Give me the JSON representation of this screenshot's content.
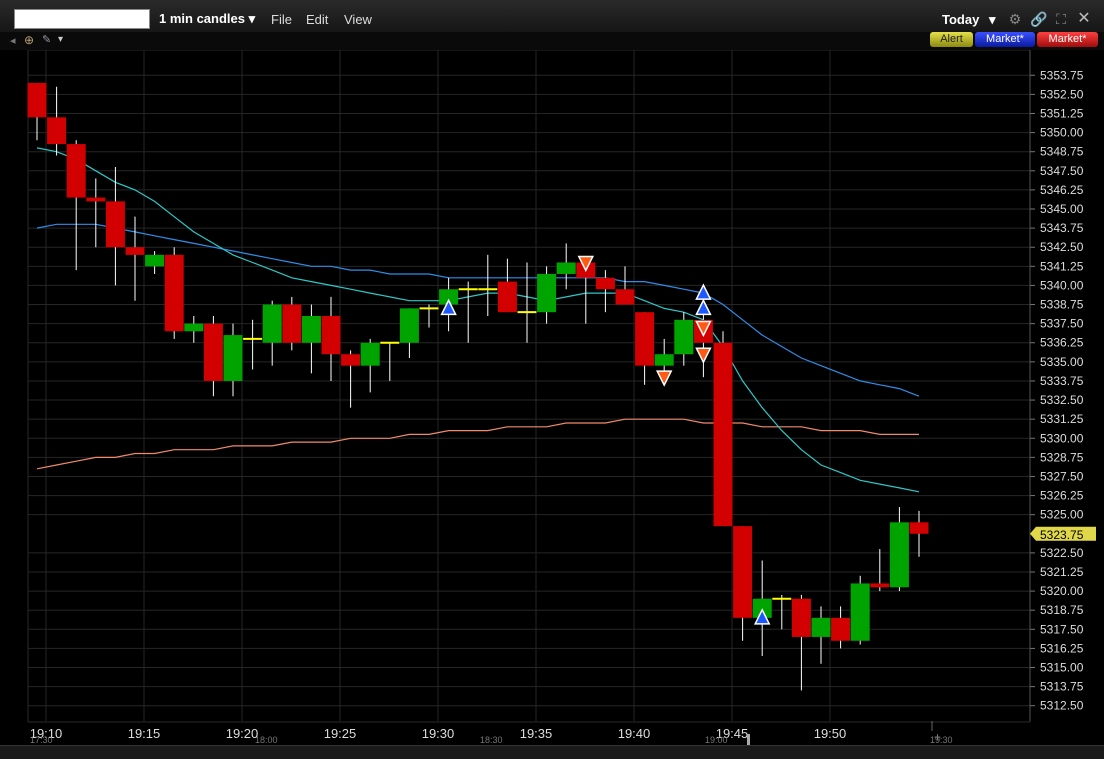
{
  "toolbar": {
    "symbol_value": "",
    "interval_label": "1 min candles",
    "menu": [
      "File",
      "Edit",
      "View"
    ],
    "period_label": "Today",
    "icons": [
      "dropdown-caret",
      "gear-icon",
      "link-icon",
      "expand-icon",
      "close-icon"
    ]
  },
  "badges": {
    "alert": "Alert",
    "market_buy": "Market*",
    "market_sell": "Market*"
  },
  "colors": {
    "up": "#00a400",
    "down": "#d20000",
    "price_tag": "#e0d84a",
    "buy_arrow": "#1f57ff",
    "sell_arrow": "#ff5a14",
    "ma_fast": "#2ec8c8",
    "ma_mid": "#2f8ee8",
    "ma_slow": "#f08a6a"
  },
  "chart_data": {
    "type": "candlestick",
    "current_price": "5323.75",
    "y_ticks": [
      "5353.75",
      "5352.50",
      "5351.25",
      "5350.00",
      "5348.75",
      "5347.50",
      "5346.25",
      "5345.00",
      "5343.75",
      "5342.50",
      "5341.25",
      "5340.00",
      "5338.75",
      "5337.50",
      "5336.25",
      "5335.00",
      "5333.75",
      "5332.50",
      "5331.25",
      "5330.00",
      "5328.75",
      "5327.50",
      "5326.25",
      "5325.00",
      "5322.50",
      "5321.25",
      "5320.00",
      "5318.75",
      "5317.50",
      "5316.25",
      "5315.00",
      "5313.75",
      "5312.50"
    ],
    "ylim": [
      5311.5,
      5354.75
    ],
    "x_ticks": [
      "19:10",
      "19:15",
      "19:20",
      "19:25",
      "19:30",
      "19:35",
      "19:40",
      "19:45",
      "19:50"
    ],
    "mini_ticks": [
      "17:30",
      "18:00",
      "18:30",
      "19:00",
      "19:30"
    ],
    "candles": [
      {
        "o": 5353.25,
        "h": 5353.25,
        "l": 5349.5,
        "c": 5351.0
      },
      {
        "o": 5351.0,
        "h": 5353.0,
        "l": 5348.5,
        "c": 5349.25
      },
      {
        "o": 5349.25,
        "h": 5349.5,
        "l": 5341.0,
        "c": 5345.75
      },
      {
        "o": 5345.75,
        "h": 5347.0,
        "l": 5342.5,
        "c": 5345.5
      },
      {
        "o": 5345.5,
        "h": 5347.75,
        "l": 5340.0,
        "c": 5342.5
      },
      {
        "o": 5342.5,
        "h": 5344.5,
        "l": 5339.0,
        "c": 5342.0
      },
      {
        "o": 5341.25,
        "h": 5342.25,
        "l": 5340.75,
        "c": 5342.0
      },
      {
        "o": 5342.0,
        "h": 5342.5,
        "l": 5336.5,
        "c": 5337.0
      },
      {
        "o": 5337.0,
        "h": 5338.0,
        "l": 5336.25,
        "c": 5337.5
      },
      {
        "o": 5337.5,
        "h": 5338.0,
        "l": 5332.75,
        "c": 5333.75
      },
      {
        "o": 5333.75,
        "h": 5337.5,
        "l": 5332.75,
        "c": 5336.75
      },
      {
        "o": 5336.5,
        "h": 5337.75,
        "l": 5334.5,
        "c": 5336.5
      },
      {
        "o": 5336.25,
        "h": 5339.0,
        "l": 5334.75,
        "c": 5338.75
      },
      {
        "o": 5338.75,
        "h": 5339.25,
        "l": 5335.75,
        "c": 5336.25
      },
      {
        "o": 5336.25,
        "h": 5338.75,
        "l": 5334.25,
        "c": 5338.0
      },
      {
        "o": 5338.0,
        "h": 5339.25,
        "l": 5333.75,
        "c": 5335.5
      },
      {
        "o": 5335.5,
        "h": 5335.75,
        "l": 5332.0,
        "c": 5334.75
      },
      {
        "o": 5334.75,
        "h": 5336.5,
        "l": 5333.0,
        "c": 5336.25
      },
      {
        "o": 5336.25,
        "h": 5336.25,
        "l": 5333.75,
        "c": 5336.25
      },
      {
        "o": 5336.25,
        "h": 5338.5,
        "l": 5335.25,
        "c": 5338.5
      },
      {
        "o": 5338.5,
        "h": 5338.75,
        "l": 5337.25,
        "c": 5338.5
      },
      {
        "o": 5338.75,
        "h": 5340.5,
        "l": 5337.0,
        "c": 5339.75
      },
      {
        "o": 5339.75,
        "h": 5340.25,
        "l": 5336.25,
        "c": 5339.75
      },
      {
        "o": 5339.75,
        "h": 5342.0,
        "l": 5338.0,
        "c": 5339.75
      },
      {
        "o": 5340.25,
        "h": 5341.75,
        "l": 5338.5,
        "c": 5338.25
      },
      {
        "o": 5338.25,
        "h": 5341.5,
        "l": 5336.25,
        "c": 5338.25
      },
      {
        "o": 5338.25,
        "h": 5341.25,
        "l": 5337.5,
        "c": 5340.75
      },
      {
        "o": 5340.75,
        "h": 5342.75,
        "l": 5339.75,
        "c": 5341.5
      },
      {
        "o": 5341.5,
        "h": 5341.5,
        "l": 5337.5,
        "c": 5340.5
      },
      {
        "o": 5340.5,
        "h": 5341.0,
        "l": 5338.25,
        "c": 5339.75
      },
      {
        "o": 5339.75,
        "h": 5341.25,
        "l": 5338.75,
        "c": 5338.75
      },
      {
        "o": 5338.25,
        "h": 5338.25,
        "l": 5333.5,
        "c": 5334.75
      },
      {
        "o": 5334.75,
        "h": 5336.5,
        "l": 5334.25,
        "c": 5335.5
      },
      {
        "o": 5335.5,
        "h": 5338.25,
        "l": 5334.75,
        "c": 5337.75
      },
      {
        "o": 5337.75,
        "h": 5338.25,
        "l": 5334.0,
        "c": 5336.25
      },
      {
        "o": 5336.25,
        "h": 5337.0,
        "l": 5325.0,
        "c": 5324.25
      },
      {
        "o": 5324.25,
        "h": 5324.25,
        "l": 5316.75,
        "c": 5318.25
      },
      {
        "o": 5318.25,
        "h": 5322.0,
        "l": 5315.75,
        "c": 5319.5
      },
      {
        "o": 5319.5,
        "h": 5319.75,
        "l": 5317.5,
        "c": 5319.5
      },
      {
        "o": 5319.5,
        "h": 5319.75,
        "l": 5313.5,
        "c": 5317.0
      },
      {
        "o": 5317.0,
        "h": 5319.0,
        "l": 5315.25,
        "c": 5318.25
      },
      {
        "o": 5318.25,
        "h": 5319.0,
        "l": 5316.25,
        "c": 5316.75
      },
      {
        "o": 5316.75,
        "h": 5321.0,
        "l": 5316.5,
        "c": 5320.5
      },
      {
        "o": 5320.5,
        "h": 5322.75,
        "l": 5320.0,
        "c": 5320.25
      },
      {
        "o": 5320.25,
        "h": 5325.5,
        "l": 5320.0,
        "c": 5324.5
      },
      {
        "o": 5324.5,
        "h": 5325.25,
        "l": 5322.25,
        "c": 5323.75
      }
    ],
    "ma_fast": [
      5349.0,
      5348.75,
      5348.25,
      5347.5,
      5346.75,
      5346.25,
      5345.5,
      5344.5,
      5343.5,
      5342.75,
      5342.0,
      5341.5,
      5341.0,
      5340.5,
      5340.25,
      5340.0,
      5339.75,
      5339.5,
      5339.25,
      5339.0,
      5339.0,
      5339.0,
      5339.25,
      5339.5,
      5339.5,
      5339.25,
      5339.0,
      5339.25,
      5339.5,
      5339.5,
      5339.5,
      5339.0,
      5338.5,
      5338.25,
      5337.75,
      5336.0,
      5333.75,
      5332.0,
      5330.5,
      5329.25,
      5328.25,
      5327.75,
      5327.25,
      5327.0,
      5326.75,
      5326.5
    ],
    "ma_mid": [
      5343.75,
      5344.0,
      5344.0,
      5344.0,
      5343.75,
      5343.5,
      5343.25,
      5343.0,
      5342.75,
      5342.5,
      5342.25,
      5342.0,
      5341.75,
      5341.5,
      5341.25,
      5341.25,
      5341.0,
      5341.0,
      5340.75,
      5340.75,
      5340.75,
      5340.5,
      5340.5,
      5340.5,
      5340.5,
      5340.5,
      5340.5,
      5340.5,
      5340.5,
      5340.5,
      5340.25,
      5340.25,
      5340.0,
      5339.75,
      5339.5,
      5338.75,
      5337.75,
      5336.75,
      5336.0,
      5335.25,
      5334.75,
      5334.25,
      5333.75,
      5333.5,
      5333.25,
      5332.75
    ],
    "ma_slow": [
      5328.0,
      5328.25,
      5328.5,
      5328.75,
      5328.75,
      5329.0,
      5329.0,
      5329.25,
      5329.25,
      5329.25,
      5329.5,
      5329.5,
      5329.5,
      5329.75,
      5329.75,
      5329.75,
      5330.0,
      5330.0,
      5330.0,
      5330.25,
      5330.25,
      5330.5,
      5330.5,
      5330.5,
      5330.75,
      5330.75,
      5330.75,
      5331.0,
      5331.0,
      5331.0,
      5331.25,
      5331.25,
      5331.25,
      5331.25,
      5331.0,
      5331.0,
      5331.0,
      5330.75,
      5330.75,
      5330.75,
      5330.5,
      5330.5,
      5330.5,
      5330.25,
      5330.25,
      5330.25
    ],
    "signals": [
      {
        "i": 21,
        "type": "buy",
        "price": 5338.5
      },
      {
        "i": 28,
        "type": "sell",
        "price": 5341.5
      },
      {
        "i": 32,
        "type": "sell",
        "price": 5334.0
      },
      {
        "i": 34,
        "type": "buy",
        "price": 5338.5
      },
      {
        "i": 34,
        "type": "buy",
        "price": 5339.5
      },
      {
        "i": 34,
        "type": "sell",
        "price": 5337.25
      },
      {
        "i": 34,
        "type": "sell",
        "price": 5335.5
      },
      {
        "i": 37,
        "type": "buy",
        "price": 5318.25
      }
    ]
  }
}
